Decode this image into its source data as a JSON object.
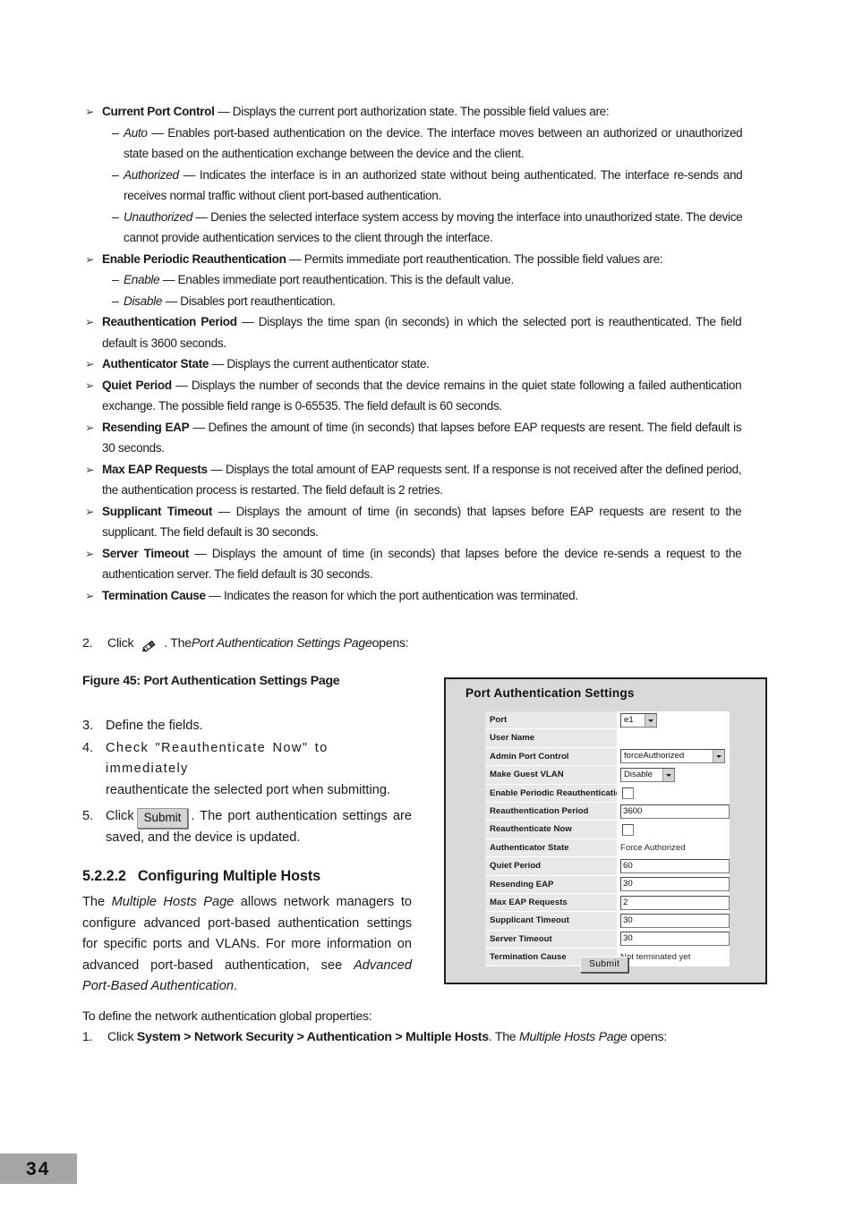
{
  "bullets": [
    {
      "term": "Current Port Control",
      "desc": " — Displays the current port authorization state. The possible field values are:",
      "subs": [
        {
          "term": "Auto",
          "desc": " — Enables port-based authentication on the device. The interface moves between an authorized or unauthorized state based on the authentication exchange between the device and the client."
        },
        {
          "term": "Authorized",
          "desc": " — Indicates the interface is in an authorized state without being authenticated. The interface re-sends and receives normal traffic without client port-based authentication."
        },
        {
          "term": "Unauthorized",
          "desc": " — Denies the selected interface system access by moving the interface into unauthorized state. The device cannot provide authentication services to the client through the interface."
        }
      ]
    },
    {
      "term": "Enable Periodic Reauthentication",
      "desc": " — Permits immediate port reauthentication. The possible field values are:",
      "subs": [
        {
          "term": "Enable",
          "desc": " — Enables immediate port reauthentication. This is the default value."
        },
        {
          "term": "Disable",
          "desc": " — Disables port reauthentication."
        }
      ]
    },
    {
      "term": "Reauthentication Period",
      "desc": " — Displays the time span (in seconds) in which the selected port is reauthenticated. The field default is 3600 seconds.",
      "subs": []
    },
    {
      "term": "Authenticator State",
      "desc": " — Displays the current authenticator state.",
      "subs": []
    },
    {
      "term": "Quiet Period",
      "desc": " — Displays the number of seconds that the device remains in the quiet state following a failed authentication exchange. The possible field range is 0-65535. The field default is 60 seconds.",
      "subs": []
    },
    {
      "term": "Resending EAP",
      "desc": " — Defines the amount of time (in seconds) that lapses before EAP requests are resent. The field default is 30 seconds.",
      "subs": []
    },
    {
      "term": "Max EAP Requests",
      "desc": " — Displays the total amount of EAP requests sent. If a response is not received after the defined period, the authentication process is restarted. The field default is 2 retries.",
      "subs": []
    },
    {
      "term": "Supplicant Timeout",
      "desc": " — Displays the amount of time (in seconds) that lapses before EAP requests are resent to the supplicant. The field default is 30 seconds.",
      "subs": []
    },
    {
      "term": "Server Timeout",
      "desc": " — Displays the amount of time (in seconds) that lapses before the device re-sends a request to the authentication server. The field default is 30 seconds.",
      "subs": []
    },
    {
      "term": "Termination Cause",
      "desc": " — Indicates the reason for which the port authentication was terminated.",
      "subs": []
    }
  ],
  "bullet_marker": "➢",
  "sub_marker": "–",
  "step2": {
    "number": "2.",
    "click_label": "Click",
    "icon": "pencil-icon",
    "after_icon_prefix": ". The ",
    "page_name": "Port Authentication Settings Page",
    "after_icon_suffix": " opens:"
  },
  "figure_caption": "Figure 45: Port Authentication Settings Page",
  "steps": [
    {
      "number": "3.",
      "text": "Define the fields."
    },
    {
      "number": "4.",
      "line1": "Check \"Reauthenticate Now\" to immediately",
      "line2": "reauthenticate the selected port when submitting."
    },
    {
      "number": "5.",
      "pre": "Click",
      "button_label": "Submit",
      "post": ". The port authentication settings are saved, and the device is updated."
    }
  ],
  "section": {
    "number": "5.2.2.2",
    "title": "Configuring Multiple Hosts",
    "para_a": "The ",
    "para_italic_1": "Multiple Hosts Page",
    "para_b": " allows network managers to configure advanced port-based authentication settings for specific ports and VLANs. For more information on advanced port-based authentication, see ",
    "para_italic_2": "Advanced Port-Based Authentication",
    "para_c": "."
  },
  "closing": {
    "lead": "To define the network authentication global properties:",
    "step_number": "1.",
    "click_label": "Click ",
    "path": "System > Network Security > Authentication > Multiple Hosts",
    "mid": ". The ",
    "page_name": "Multiple Hosts Page",
    "tail": " opens:"
  },
  "page_number": "34",
  "screenshot": {
    "title": "Port Authentication Settings",
    "rows": [
      {
        "label": "Port",
        "kind": "select",
        "value": "e1"
      },
      {
        "label": "User Name",
        "kind": "empty",
        "value": ""
      },
      {
        "label": "Admin Port Control",
        "kind": "select",
        "value": "forceAuthorized"
      },
      {
        "label": "Make Guest VLAN",
        "kind": "select",
        "value": "Disable"
      },
      {
        "label": "Enable Periodic Reauthentication",
        "kind": "checkbox",
        "value": "unchecked"
      },
      {
        "label": "Reauthentication Period",
        "kind": "text",
        "value": "3600"
      },
      {
        "label": "Reauthenticate Now",
        "kind": "checkbox",
        "value": "unchecked"
      },
      {
        "label": "Authenticator State",
        "kind": "readonly",
        "value": "Force Authorized"
      },
      {
        "label": "Quiet Period",
        "kind": "text",
        "value": "60"
      },
      {
        "label": "Resending EAP",
        "kind": "text",
        "value": "30"
      },
      {
        "label": "Max EAP Requests",
        "kind": "text",
        "value": "2"
      },
      {
        "label": "Supplicant Timeout",
        "kind": "text",
        "value": "30"
      },
      {
        "label": "Server Timeout",
        "kind": "text",
        "value": "30"
      },
      {
        "label": "Termination Cause",
        "kind": "readonly",
        "value": "Not terminated yet"
      }
    ],
    "submit_label": "Submit"
  },
  "colors": {
    "page_band": "#a6a6a6",
    "dialog_bg": "#d9d9d9",
    "dialog_border": "#1d1d1d",
    "row_label_bg": "#e8e8e8",
    "button_face": "#d4d4d4"
  }
}
